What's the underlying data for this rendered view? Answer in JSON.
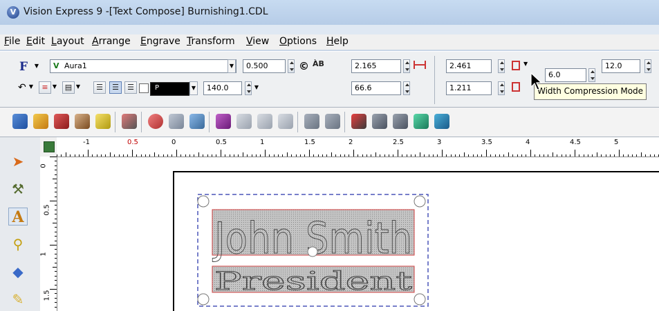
{
  "window": {
    "title": "Vision Express 9 -[Text Compose] Burnishing1.CDL"
  },
  "menu": [
    "File",
    "Edit",
    "Layout",
    "Arrange",
    "Engrave",
    "Transform",
    "View",
    "Options",
    "Help"
  ],
  "propbar": {
    "font_glyph": "F",
    "font_name_prefix": "V",
    "font_name": "Aura1",
    "height_value": "0.500",
    "width_value": "2.165",
    "x_value": "2.461",
    "y_value": "1.211",
    "spacing_value": "6.0",
    "size_value": "12.0",
    "angle_value": "140.0",
    "compression_value": "66.6",
    "color_label": "P",
    "copyright_glyph": "©",
    "char_glyph": "ÀB"
  },
  "tooltip": "Width Compression Mode",
  "ruler": {
    "h_labels": [
      "-1",
      "0.5",
      "0",
      "0.5",
      "1",
      "1.5",
      "2",
      "2.5",
      "3",
      "3.5",
      "4",
      "4.5",
      "5"
    ],
    "v_labels": [
      "0",
      "0.5",
      "1",
      "1.5"
    ]
  },
  "canvas": {
    "line1": "John Smith",
    "line2": "President"
  },
  "colors": {
    "selection": "#4a55b8",
    "text_box": "#d04040",
    "ruler_red": "#c00000"
  }
}
